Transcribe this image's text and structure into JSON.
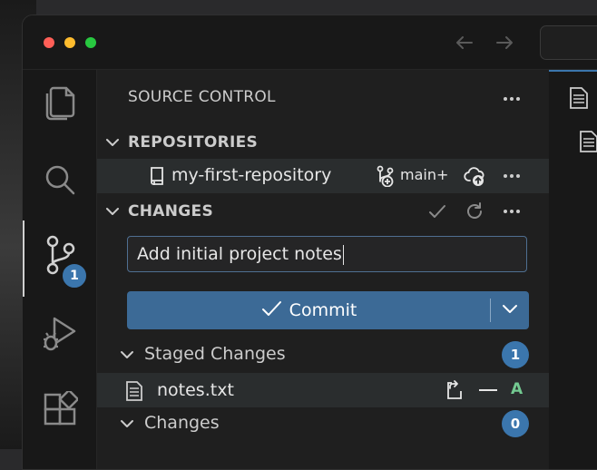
{
  "window": {
    "controls": [
      "close",
      "minimize",
      "zoom"
    ],
    "nav": {
      "back_icon": "arrow-left-icon",
      "forward_icon": "arrow-right-icon"
    }
  },
  "activity_bar": {
    "items": [
      {
        "name": "explorer",
        "icon": "files-icon"
      },
      {
        "name": "search",
        "icon": "search-icon"
      },
      {
        "name": "source-control",
        "icon": "source-control-icon",
        "active": true,
        "badge": "1"
      },
      {
        "name": "run-debug",
        "icon": "run-debug-icon"
      },
      {
        "name": "extensions",
        "icon": "extensions-icon"
      }
    ]
  },
  "sidebar": {
    "title": "SOURCE CONTROL",
    "repositories": {
      "header": "REPOSITORIES",
      "repo_name": "my-first-repository",
      "branch": "main+",
      "publish_icon": "cloud-upload-icon"
    },
    "changes": {
      "header": "CHANGES",
      "message_value": "Add initial project notes",
      "commit_label": "Commit",
      "groups": [
        {
          "label": "Staged Changes",
          "count": "1",
          "files": [
            {
              "name": "notes.txt",
              "status": "A"
            }
          ]
        },
        {
          "label": "Changes",
          "count": "0",
          "files": []
        }
      ]
    }
  },
  "colors": {
    "accent": "#3b76ad",
    "commit_button": "#3c6a96",
    "added_status": "#73c991"
  }
}
